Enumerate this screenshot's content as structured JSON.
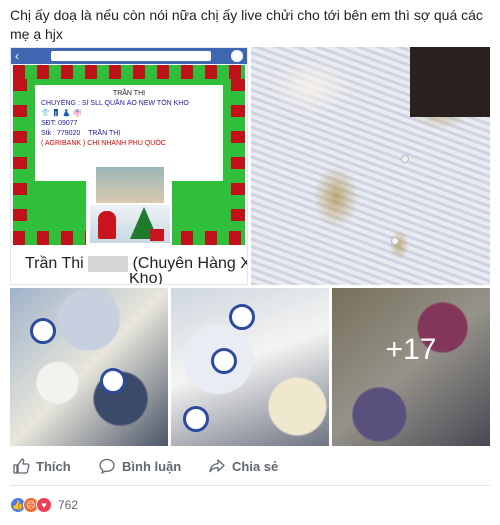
{
  "post": {
    "text": "Chị ấy doạ là nếu còn nói nữa chị ấy live chửi cho tới bên em thì sợ quá các mẹ ạ hjx"
  },
  "photos": {
    "profile_shot": {
      "card_lines": {
        "name": "TRẦN THỊ",
        "specialty": "CHUYÊNG : SỈ SLL QUẦN ÁO NEW TỒN KHO",
        "phone": "SĐT: 09077",
        "account": "Stk : 779020",
        "account_name": "TRẦN THỊ",
        "bank": "( AGRIBANK ) CHI NHÁNH PHÚ QUỐC"
      },
      "profile_name_prefix": "Trần Thi",
      "profile_name_suffix": "(Chuyên Hàng Xã",
      "profile_name_line2": "Kho)"
    },
    "more_count": "+17"
  },
  "actions": {
    "like": "Thích",
    "comment": "Bình luận",
    "share": "Chia sẻ"
  },
  "reactions": {
    "count": "762"
  },
  "colors": {
    "facebook_blue": "#4267b2",
    "like": "#4a7ce8",
    "angry": "#f06b2e",
    "love": "#f33e58"
  }
}
